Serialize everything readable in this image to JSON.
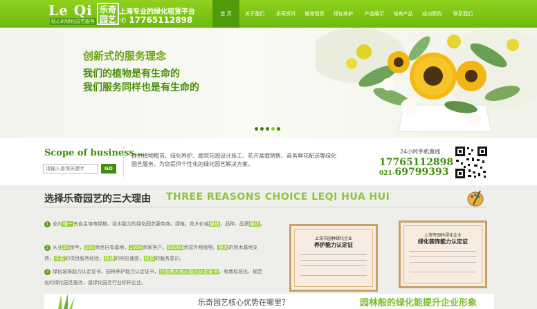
{
  "header": {
    "logo_letters": "Le Qi",
    "logo_cn": "乐奇园艺",
    "logo_sub": "贴心的绿化园艺服务",
    "slogan": "上海专业的绿化租赁平台",
    "phone": "17765112898",
    "nav": [
      "首 页",
      "关于我们",
      "乐奇资讯",
      "植物租赁",
      "绿化养护",
      "产品展示",
      "培育产品",
      "成功案例",
      "联系我们"
    ],
    "active_nav": 0
  },
  "banner": {
    "line1": "创新式的服务理念",
    "line2": "我们的植物是有生命的",
    "line3": "我们服务同样也是有生命的",
    "slides": 5,
    "active_slide": 4
  },
  "business": {
    "title": "Scope of business...",
    "search_placeholder": "请输入查询关键字",
    "go_label": "GO",
    "text": "提供植物租赁、绿化养护、庭院花园设计施工、花卉盆栽销售、商务鲜花配送等绿化园艺服务，为您提供个性化的绿化园艺解决方案。",
    "hotline_label": "24小时手机直线",
    "hotline_1": "17765112898",
    "hotline_2_prefix": "021-",
    "hotline_2": "69799393"
  },
  "reasons": {
    "heading": "选择乐奇园艺的三大理由",
    "heading_en": "THREE REASONS  CHOICE LEQI HUA HUI",
    "items": [
      {
        "num": "1",
        "a": "业内",
        "h1": "唯一",
        "b": "有自主培育绿植、花木能力的绿化园艺服务商。绿植、花木价格",
        "h2": "最低",
        "c": "，品种、品质",
        "h3": "最优",
        "d": "。"
      },
      {
        "num": "2",
        "a": "从业",
        "h1": "20",
        "b": "余年，",
        "h2": "300",
        "c": "余亩自有基地，",
        "h3": "1000",
        "d": "余家客户，",
        "h4": "90000",
        "e": "余盆外租植物。",
        "h5": "强大",
        "f": "的苗木基地支持，",
        "h6": "丰富",
        "g": "的项目服务经验，",
        "h7": "快速",
        "i": "的响应速度，",
        "h8": "优质",
        "j": "的服务意识。"
      },
      {
        "num": "3",
        "a": "绿化装饰能力认定证书，园林养护能力认定证书，",
        "h1": "行业两大核心能力认定证书",
        "b": "，有着标准化、规范化的绿化园艺服务，是绿化园艺行业标杆企业。"
      }
    ],
    "cert_a_org": "上海市园林绿化企业",
    "cert_a_title": "养护能力认定证",
    "cert_b_org": "上海市园林绿化企业",
    "cert_b_title": "绿化装饰能力认定证"
  },
  "bottom": {
    "question": "乐奇园艺核心优势在哪里？",
    "tagline": "园林般的绿化能提升企业形象"
  }
}
